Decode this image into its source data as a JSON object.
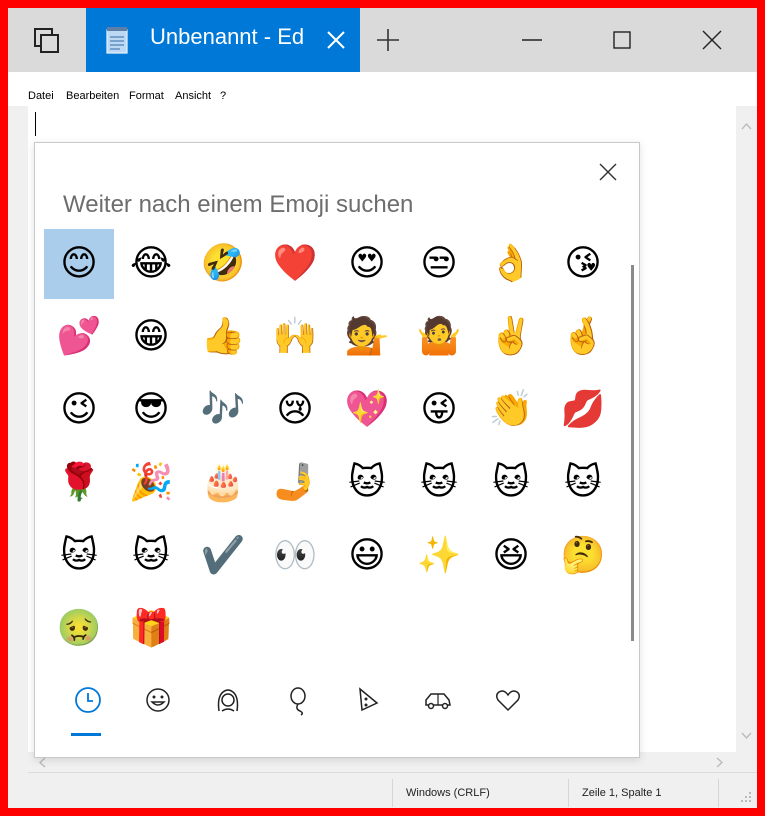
{
  "window": {
    "tab_title": "Unbenannt - Ed",
    "accent": "#0078d7",
    "frame_border": "#ff0000"
  },
  "menu": {
    "items": [
      "Datei",
      "Bearbeiten",
      "Format",
      "Ansicht",
      "?"
    ]
  },
  "emoji_panel": {
    "search_hint": "Weiter nach einem Emoji suchen",
    "selected_index": 0,
    "emojis": [
      "😊",
      "😂",
      "🤣",
      "❤️",
      "😍",
      "😒",
      "👌",
      "😘",
      "💕",
      "😁",
      "👍",
      "🙌",
      "💁",
      "🤷",
      "✌️",
      "🤞",
      "😉",
      "😎",
      "🎶",
      "😢",
      "💖",
      "😜",
      "👏",
      "💋",
      "🌹",
      "🎉",
      "🎂",
      "🤳",
      "🐱",
      "🐱",
      "🐱",
      "🐱",
      "🐱",
      "🐱",
      "✔️",
      "👀",
      "😃",
      "✨",
      "😆",
      "🤔",
      "🤢",
      "🎁"
    ],
    "categories": [
      {
        "name": "recent",
        "icon": "clock-icon"
      },
      {
        "name": "smileys",
        "icon": "smiley-icon"
      },
      {
        "name": "people",
        "icon": "person-icon"
      },
      {
        "name": "celebration",
        "icon": "balloon-icon"
      },
      {
        "name": "food",
        "icon": "pizza-icon"
      },
      {
        "name": "travel",
        "icon": "car-icon"
      },
      {
        "name": "symbols",
        "icon": "heart-icon"
      }
    ]
  },
  "status": {
    "encoding": "Windows (CRLF)",
    "position": "Zeile 1, Spalte 1"
  }
}
